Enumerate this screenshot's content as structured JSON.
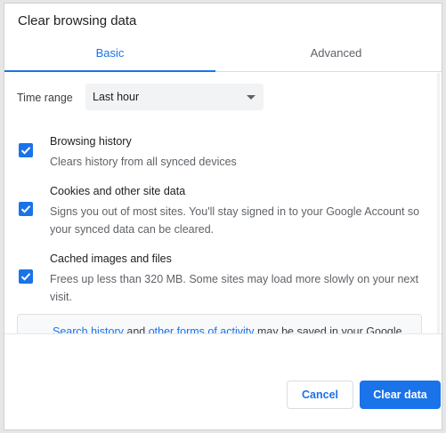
{
  "dialog": {
    "title": "Clear browsing data",
    "tabs": [
      {
        "label": "Basic",
        "active": true
      },
      {
        "label": "Advanced",
        "active": false
      }
    ],
    "time_range": {
      "label": "Time range",
      "selected": "Last hour"
    },
    "options": [
      {
        "title": "Browsing history",
        "description": "Clears history from all synced devices",
        "checked": true
      },
      {
        "title": "Cookies and other site data",
        "description": "Signs you out of most sites. You'll stay signed in to your Google Account so your synced data can be cleared.",
        "checked": true
      },
      {
        "title": "Cached images and files",
        "description": "Frees up less than 320 MB. Some sites may load more slowly on your next visit.",
        "checked": true
      }
    ],
    "info": {
      "icon": "google-g-icon",
      "link1": "Search history",
      "text1": " and ",
      "link2": "other forms of activity",
      "text2": " may be saved in your Google Account when you're signed in. You can delete them anytime."
    },
    "buttons": {
      "cancel": "Cancel",
      "clear": "Clear data"
    },
    "colors": {
      "accent": "#1a73e8",
      "secondary_text": "#5f6368"
    }
  }
}
